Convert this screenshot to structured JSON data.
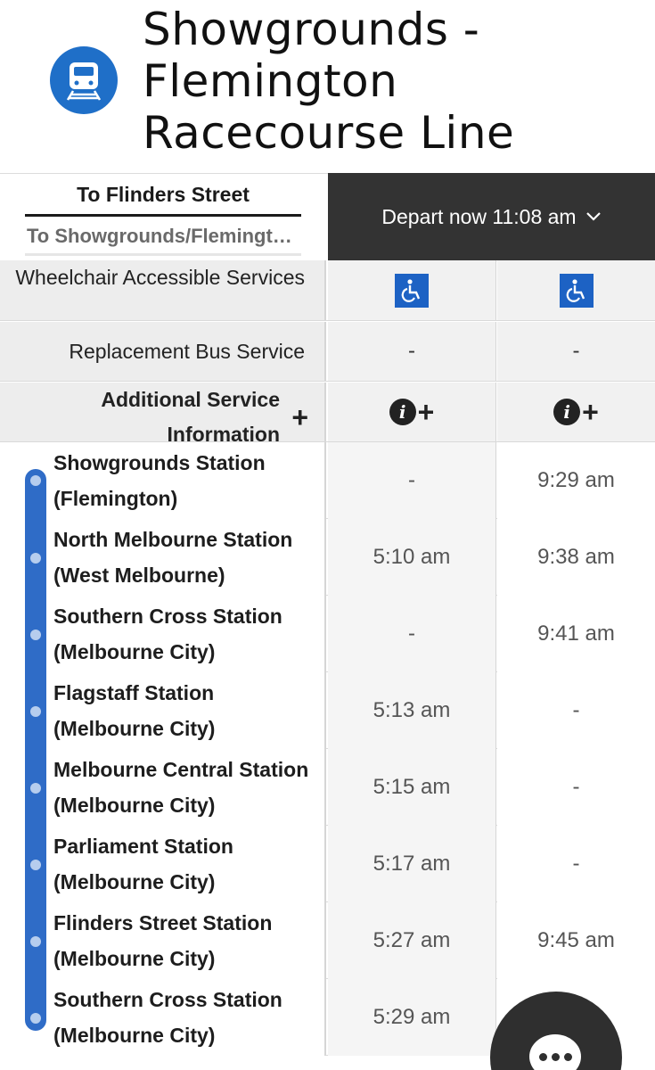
{
  "header": {
    "title": "Showgrounds - Flemington Racecourse Line",
    "icon": "train-icon",
    "accent": "#1f6fc8"
  },
  "direction_tabs": [
    {
      "label": "To Flinders Street",
      "active": true
    },
    {
      "label": "To Showgrounds/Flemington Racecourse",
      "active": false
    }
  ],
  "depart": {
    "label": "Depart now 11:08 am"
  },
  "info_rows": {
    "wheelchair": {
      "label": "Wheelchair Accessible Services",
      "values": [
        "wheelchair-icon",
        "wheelchair-icon"
      ]
    },
    "bus": {
      "label": "Replacement Bus Service",
      "values": [
        "-",
        "-"
      ]
    },
    "additional": {
      "label": "Additional Service Information",
      "values": [
        "info-plus-icon",
        "info-plus-icon"
      ]
    }
  },
  "stops": [
    {
      "name": "Showgrounds Station (Flemington)",
      "times": [
        "-",
        "9:29 am"
      ]
    },
    {
      "name": "North Melbourne Station (West Melbourne)",
      "times": [
        "5:10 am",
        "9:38 am"
      ]
    },
    {
      "name": "Southern Cross Station (Melbourne City)",
      "times": [
        "-",
        "9:41 am"
      ]
    },
    {
      "name": "Flagstaff Station (Melbourne City)",
      "times": [
        "5:13 am",
        "-"
      ]
    },
    {
      "name": "Melbourne Central Station (Melbourne City)",
      "times": [
        "5:15 am",
        "-"
      ]
    },
    {
      "name": "Parliament Station (Melbourne City)",
      "times": [
        "5:17 am",
        "-"
      ]
    },
    {
      "name": "Flinders Street Station (Melbourne City)",
      "times": [
        "5:27 am",
        "9:45 am"
      ]
    },
    {
      "name": "Southern Cross Station (Melbourne City)",
      "times": [
        "5:29 am",
        ""
      ]
    }
  ],
  "chat": {
    "icon": "chat-icon"
  }
}
